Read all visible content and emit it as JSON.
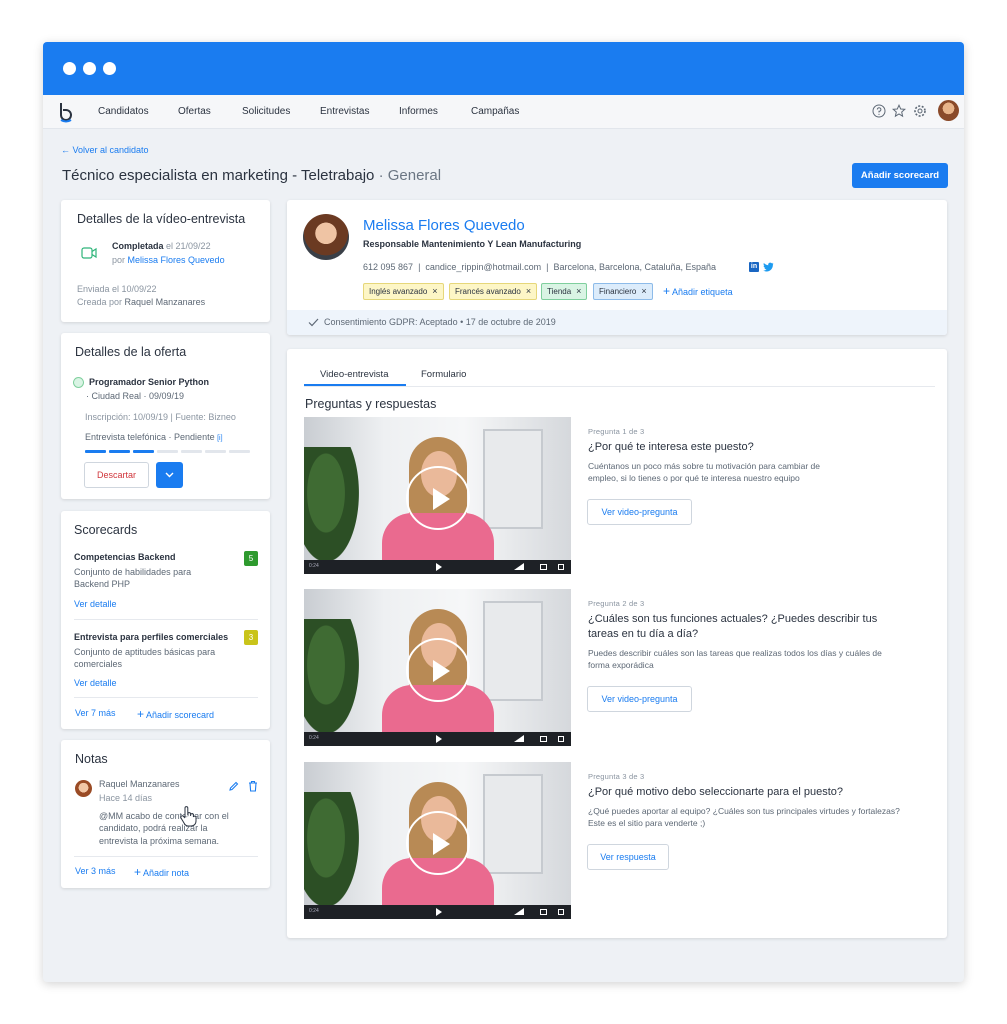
{
  "nav": {
    "items": [
      "Candidatos",
      "Ofertas",
      "Solicitudes",
      "Entrevistas",
      "Informes",
      "Campañas"
    ]
  },
  "header": {
    "back_label": "Volver al candidato",
    "title": "Técnico especialista en marketing - Teletrabajo",
    "title_suffix": "· General",
    "add_scorecard_button": "Añadir scorecard"
  },
  "interview_details": {
    "title": "Detalles de la vídeo-entrevista",
    "status": "Completada",
    "date_text": "el 21/09/22",
    "by_prefix": "por",
    "by_name": "Melissa Flores Quevedo",
    "sent": "Enviada el 10/09/22",
    "created_prefix": "Creada por",
    "created_by": "Raquel Manzanares"
  },
  "offer_details": {
    "title": "Detalles de la oferta",
    "offer_name": "Programador Senior Python",
    "offer_meta": "· Ciudad Real · 09/09/19",
    "inscription": "Inscripción: 10/09/19  | Fuente: Bizneo",
    "stage": "Entrevista telefónica · Pendiente",
    "info_marker": "[i]",
    "progress_filled": 3,
    "progress_total": 7,
    "discard_button": "Descartar"
  },
  "scorecards": {
    "title": "Scorecards",
    "items": [
      {
        "name": "Competencias Backend",
        "desc_line1": "Conjunto de habilidades para",
        "desc_line2": "Backend PHP",
        "score": "5",
        "detail_link": "Ver detalle",
        "color": "#2e9a2e"
      },
      {
        "name": "Entrevista para perfiles comerciales",
        "desc_line1": "Conjunto de aptitudes básicas para",
        "desc_line2": "comerciales",
        "score": "3",
        "detail_link": "Ver detalle",
        "color": "#c9c41a"
      }
    ],
    "more_link": "Ver 7 más",
    "add_link": "Añadir scorecard"
  },
  "notes": {
    "title": "Notas",
    "author": "Raquel Manzanares",
    "time": "Hace 14 días",
    "line1": "@MM acabo de contactar con el",
    "line2": "candidato, podrá realizar la",
    "line3": "entrevista la próxima semana.",
    "more_link": "Ver 3 más",
    "add_link": "Añadir nota"
  },
  "candidate": {
    "name": "Melissa Flores Quevedo",
    "role": "Responsable Mantenimiento Y Lean Manufacturing",
    "phone": "612 095 867",
    "email": "candice_rippin@hotmail.com",
    "location": "Barcelona, Barcelona, Cataluña, España",
    "tags": [
      {
        "label": "Inglés avanzado",
        "bg": "#fdf6c6",
        "border": "#e6d77a"
      },
      {
        "label": "Francés avanzado",
        "bg": "#fdf6c6",
        "border": "#e6d77a"
      },
      {
        "label": "Tienda",
        "bg": "#d9f4e4",
        "border": "#7fcf9d"
      },
      {
        "label": "Financiero",
        "bg": "#dcecfb",
        "border": "#8dbbe9"
      }
    ],
    "add_tag": "Añadir etiqueta",
    "gdpr": "Consentimiento GDPR: Aceptado • 17 de octubre de 2019"
  },
  "main": {
    "tabs": [
      "Video-entrevista",
      "Formulario"
    ],
    "section_title": "Preguntas y respuestas",
    "questions": [
      {
        "num": "Pregunta 1 de 3",
        "title1": "¿Por qué te interesa este puesto?",
        "title2": "",
        "desc1": "Cuéntanos un poco más sobre tu motivación para cambiar de",
        "desc2": "empleo, si lo tienes o por qué te interesa nuestro equipo",
        "button": "Ver video-pregunta",
        "time": "0:24"
      },
      {
        "num": "Pregunta 2 de 3",
        "title1": "¿Cuáles son tus funciones actuales? ¿Puedes describir tus",
        "title2": "tareas en tu día a día?",
        "desc1": "Puedes describir cuáles son las tareas que realizas todos los días y cuáles de",
        "desc2": "forma exporádica",
        "button": "Ver video-pregunta",
        "time": "0:24"
      },
      {
        "num": "Pregunta 3 de 3",
        "title1": "¿Por qué motivo debo seleccionarte para el puesto?",
        "title2": "",
        "desc1": "¿Qué puedes aportar al equipo? ¿Cuáles son tus principales virtudes y fortalezas?",
        "desc2": "Este es el sitio para venderte ;)",
        "button": "Ver respuesta",
        "time": "0:24"
      }
    ]
  }
}
